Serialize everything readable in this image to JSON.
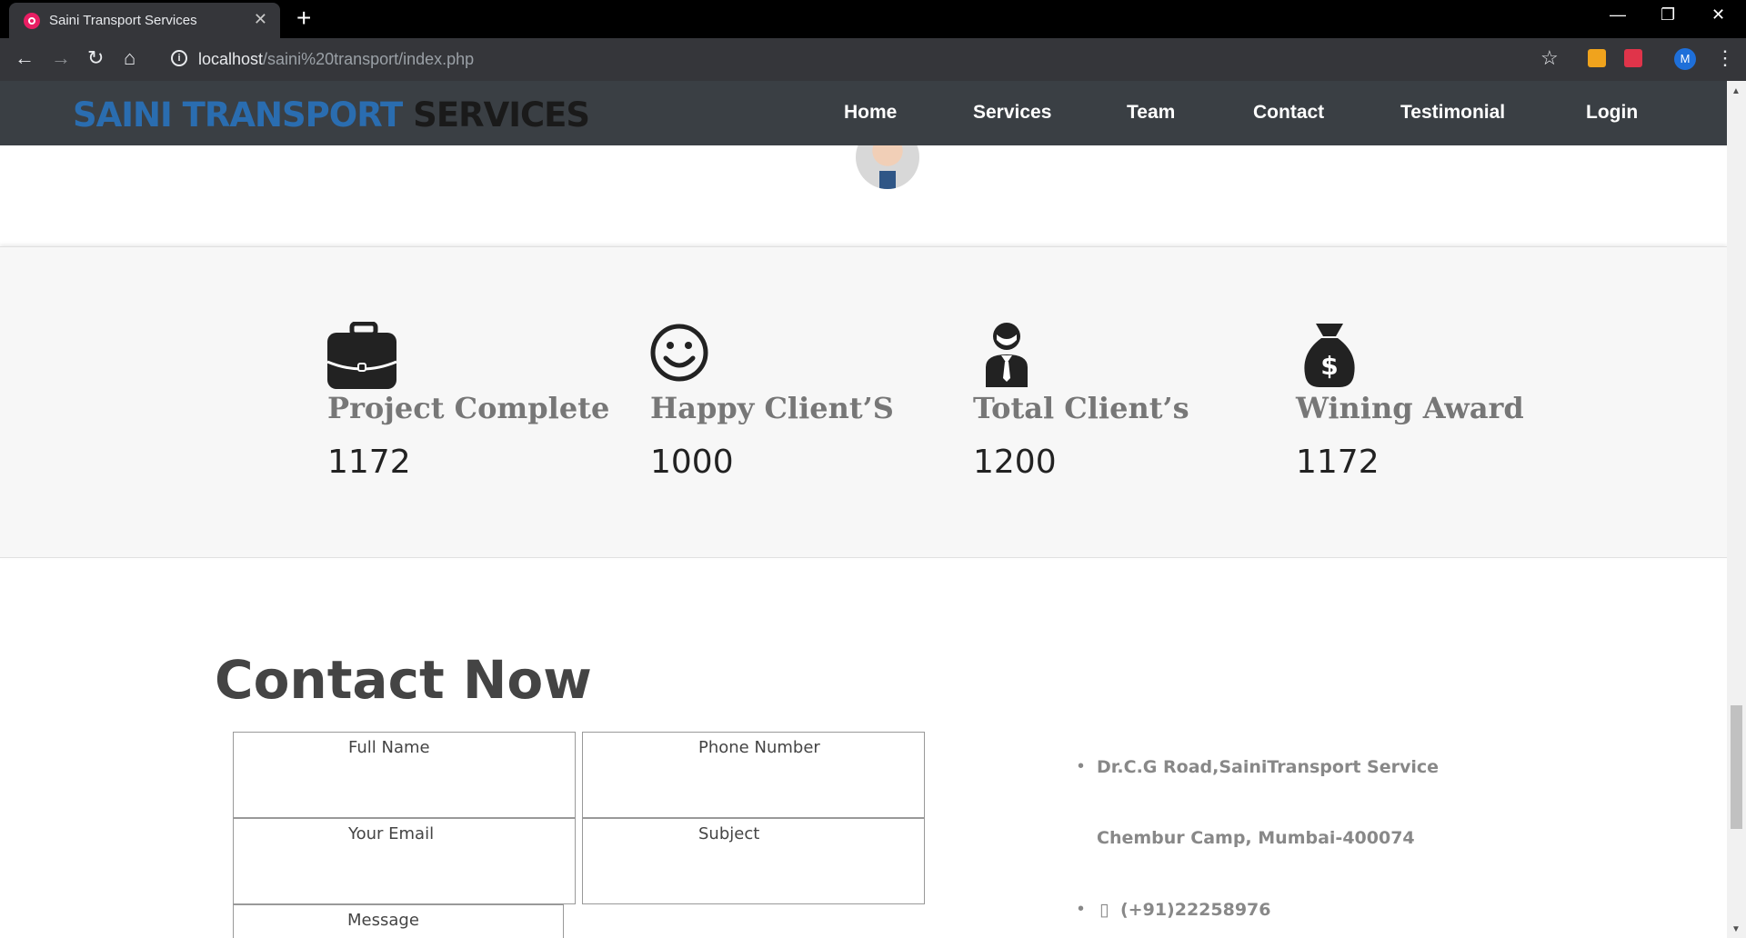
{
  "browser": {
    "tab_title": "Saini Transport Services",
    "url_host": "localhost",
    "url_path": "/saini%20transport/index.php",
    "profile_initial": "M"
  },
  "site": {
    "logo_part1": "SAINI TRANSPORT",
    "logo_part2": "SERVICES",
    "nav": [
      "Home",
      "Services",
      "Team",
      "Contact",
      "Testimonial",
      "Login"
    ]
  },
  "stats": [
    {
      "icon": "briefcase-icon",
      "title": "Project Complete",
      "value": "1172"
    },
    {
      "icon": "smiley-icon",
      "title": "Happy Client’S",
      "value": "1000"
    },
    {
      "icon": "business-person-icon",
      "title": "Total Client’s",
      "value": "1200"
    },
    {
      "icon": "money-bag-icon",
      "title": "Wining Award",
      "value": "1172"
    }
  ],
  "contact": {
    "heading": "Contact Now",
    "placeholders": {
      "full_name": "Full Name",
      "phone": "Phone Number",
      "email": "Your Email",
      "subject": "Subject",
      "message": "Message"
    },
    "address_line1": "Dr.C.G Road,SainiTransport Service",
    "address_line2": "Chembur Camp, Mumbai-400074",
    "phone": "(+91)22258976"
  },
  "colors": {
    "nav_bg": "#3a3f44",
    "logo_blue": "#2a6db0",
    "stats_bg": "#f7f7f7"
  }
}
